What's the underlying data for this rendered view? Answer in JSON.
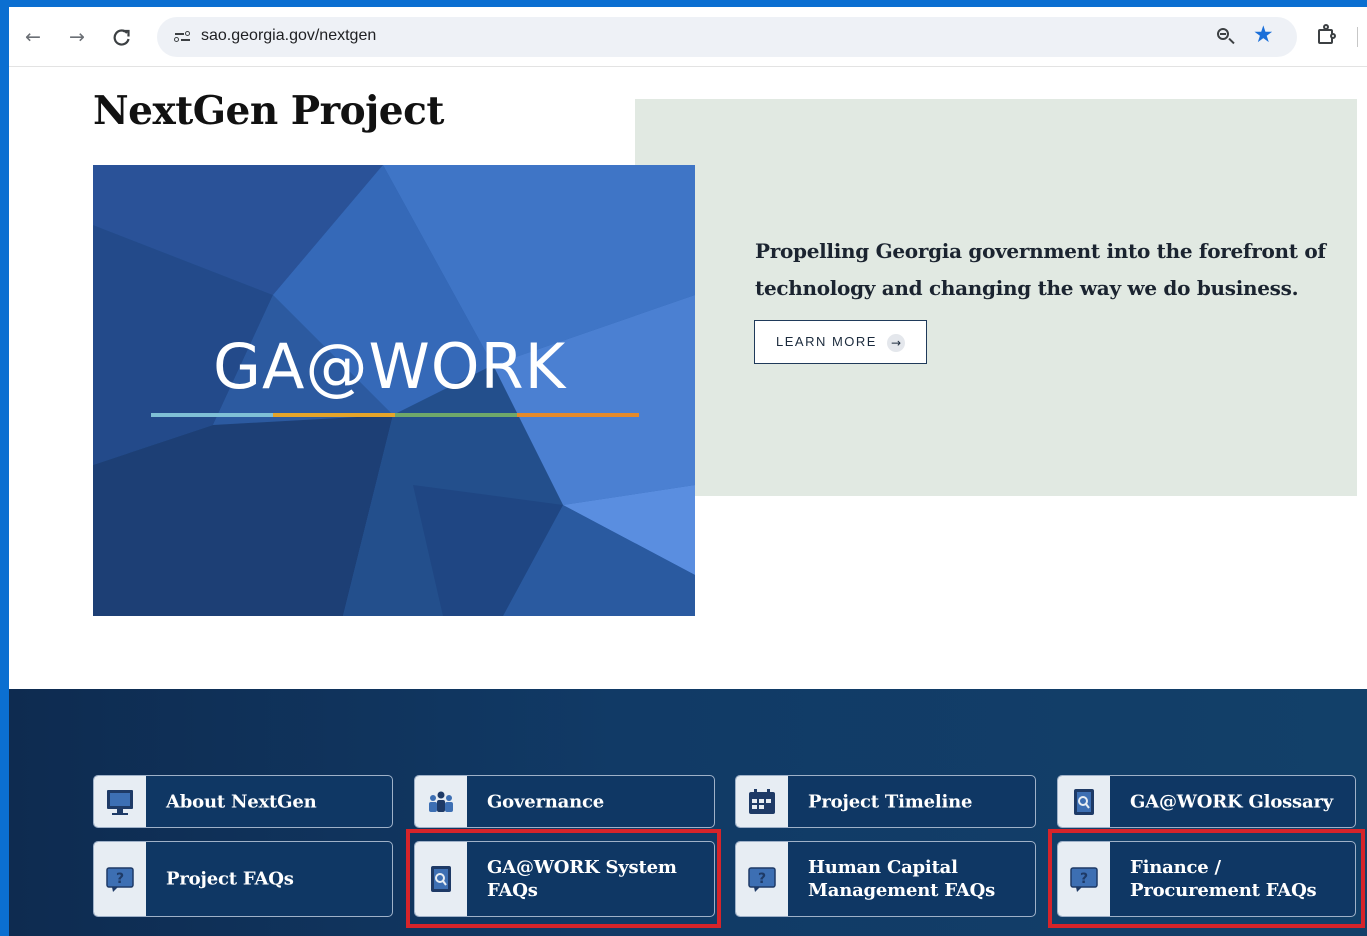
{
  "browser": {
    "url": "sao.georgia.gov/nextgen",
    "back_icon": "←",
    "forward_icon": "→",
    "reload_icon": "C",
    "star_icon": "★"
  },
  "page": {
    "title": "NextGen Project",
    "hero": {
      "logo_text": "GA@WORK",
      "tagline": "Propelling Georgia government into the forefront of technology and changing the way we do business.",
      "learn_more_label": "LEARN MORE",
      "learn_more_arrow": "→"
    }
  },
  "nav_cards": [
    {
      "label": "About NextGen",
      "icon": "monitor-icon"
    },
    {
      "label": "Governance",
      "icon": "people-icon"
    },
    {
      "label": "Project Timeline",
      "icon": "calendar-icon"
    },
    {
      "label": "GA@WORK Glossary",
      "icon": "book-search-icon"
    },
    {
      "label": "Project FAQs",
      "icon": "question-bubble-icon"
    },
    {
      "label": "GA@WORK System\nFAQs",
      "icon": "book-search-icon"
    },
    {
      "label": "Human Capital\nManagement FAQs",
      "icon": "question-bubble-icon"
    },
    {
      "label": "Finance /\nProcurement FAQs",
      "icon": "question-bubble-icon"
    }
  ],
  "colors": {
    "accent_blue": "#1a6fd9",
    "hero_panel": "#e1e9e2",
    "nav_bg": "#113a66",
    "highlight_red": "#d6242a",
    "logo_line": [
      "#7fc0d6",
      "#e5a52a",
      "#6fa86a",
      "#e58a2a"
    ]
  }
}
